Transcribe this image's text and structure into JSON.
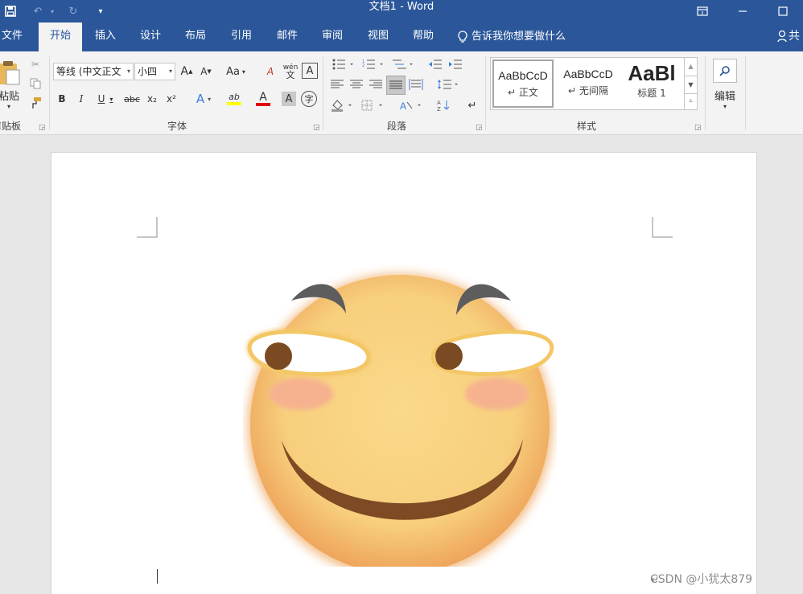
{
  "window": {
    "title": "文档1  -  Word"
  },
  "qat": {
    "save_icon": "save-icon",
    "undo_icon": "undo-icon",
    "redo_icon": "redo-icon",
    "customize_icon": "customize-qat-icon"
  },
  "tabs": [
    "文件",
    "开始",
    "插入",
    "设计",
    "布局",
    "引用",
    "邮件",
    "审阅",
    "视图",
    "帮助"
  ],
  "active_tab": "开始",
  "tell_me": "告诉我你想要做什么",
  "share_label": "共",
  "ribbon": {
    "clipboard": {
      "paste_label": "粘贴",
      "group_label": "剪贴板"
    },
    "font": {
      "font_name": "等线 (中文正文",
      "font_size": "小四",
      "grow": "A",
      "shrink": "A",
      "change_case": "Aa",
      "clear_format": "A",
      "phonetic": "wén",
      "char_border": "A",
      "bold": "B",
      "italic": "I",
      "underline": "U",
      "strike": "abc",
      "subscript": "x₂",
      "superscript": "x²",
      "text_effects": "A",
      "highlight": "ab",
      "font_color": "A",
      "char_shading": "A",
      "enclose": "字",
      "group_label": "字体"
    },
    "paragraph": {
      "group_label": "段落"
    },
    "styles": {
      "tiles": [
        {
          "sample": "AaBbCcD",
          "name": "正文"
        },
        {
          "sample": "AaBbCcD",
          "name": "无间隔"
        },
        {
          "sample": "AaBl",
          "name": "标题 1"
        }
      ],
      "group_label": "样式"
    },
    "editing": {
      "label": "编辑"
    }
  },
  "watermark": "CSDN @小犹太879",
  "colors": {
    "brand": "#2b579a",
    "ribbon": "#f3f3f3",
    "doc_bg": "#e6e6e6"
  }
}
